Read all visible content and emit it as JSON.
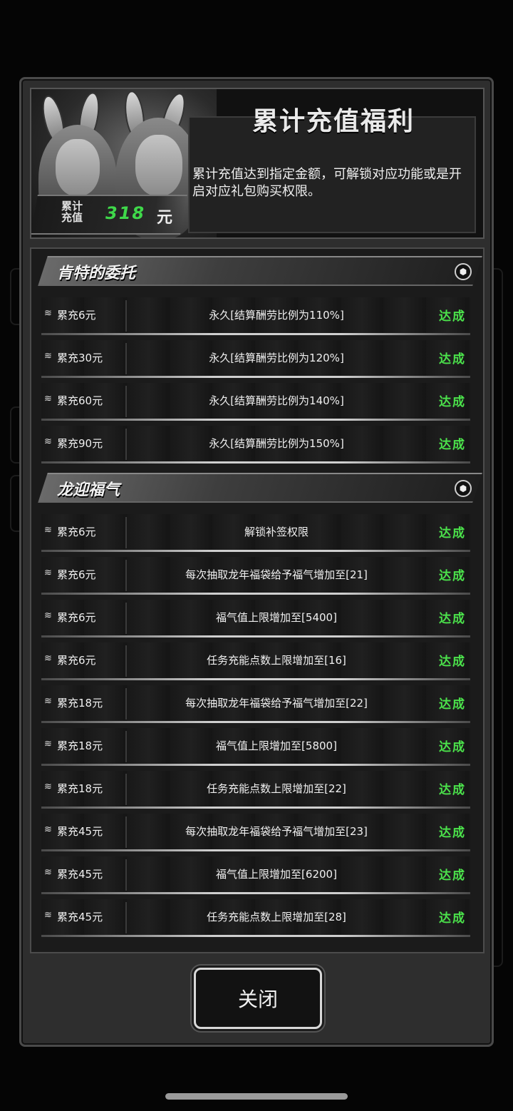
{
  "header": {
    "title": "累计充值福利",
    "description": "累计充值达到指定金额，可解锁对应功能或是开启对应礼包购买权限。",
    "total_label": "累计\n充值",
    "total_value": "318",
    "total_unit": "元"
  },
  "sections": [
    {
      "title": "肯特的委托",
      "rows": [
        {
          "amount": "累充6元",
          "desc": "永久[结算酬劳比例为110%]",
          "status": "达成"
        },
        {
          "amount": "累充30元",
          "desc": "永久[结算酬劳比例为120%]",
          "status": "达成"
        },
        {
          "amount": "累充60元",
          "desc": "永久[结算酬劳比例为140%]",
          "status": "达成"
        },
        {
          "amount": "累充90元",
          "desc": "永久[结算酬劳比例为150%]",
          "status": "达成"
        }
      ]
    },
    {
      "title": "龙迎福气",
      "rows": [
        {
          "amount": "累充6元",
          "desc": "解锁补签权限",
          "status": "达成"
        },
        {
          "amount": "累充6元",
          "desc": "每次抽取龙年福袋给予福气增加至[21]",
          "status": "达成"
        },
        {
          "amount": "累充6元",
          "desc": "福气值上限增加至[5400]",
          "status": "达成"
        },
        {
          "amount": "累充6元",
          "desc": "任务充能点数上限增加至[16]",
          "status": "达成"
        },
        {
          "amount": "累充18元",
          "desc": "每次抽取龙年福袋给予福气增加至[22]",
          "status": "达成"
        },
        {
          "amount": "累充18元",
          "desc": "福气值上限增加至[5800]",
          "status": "达成"
        },
        {
          "amount": "累充18元",
          "desc": "任务充能点数上限增加至[22]",
          "status": "达成"
        },
        {
          "amount": "累充45元",
          "desc": "每次抽取龙年福袋给予福气增加至[23]",
          "status": "达成"
        },
        {
          "amount": "累充45元",
          "desc": "福气值上限增加至[6200]",
          "status": "达成"
        },
        {
          "amount": "累充45元",
          "desc": "任务充能点数上限增加至[28]",
          "status": "达成"
        }
      ]
    }
  ],
  "close_label": "关闭",
  "colors": {
    "accent_green": "#4be24b",
    "total_green": "#3fd84a"
  },
  "icons": {
    "row_icon": "stack-icon",
    "section_icon": "hexagon-icon"
  }
}
